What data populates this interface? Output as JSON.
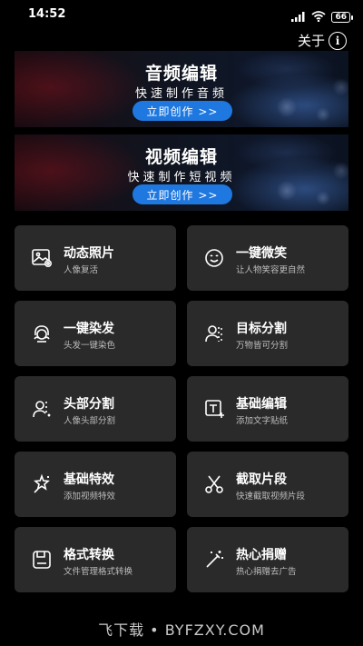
{
  "status_bar": {
    "time": "14:52",
    "battery": "66"
  },
  "header": {
    "about_label": "关于"
  },
  "banners": [
    {
      "title": "音频编辑",
      "subtitle": "快速制作音频",
      "button": "立即创作 >>"
    },
    {
      "title": "视频编辑",
      "subtitle": "快速制作短视频",
      "button": "立即创作 >>"
    }
  ],
  "features": [
    {
      "title": "动态照片",
      "subtitle": "人像复活",
      "icon": "photo-icon"
    },
    {
      "title": "一键微笑",
      "subtitle": "让人物笑容更自然",
      "icon": "smile-icon"
    },
    {
      "title": "一键染发",
      "subtitle": "头发一键染色",
      "icon": "hair-dye-icon"
    },
    {
      "title": "目标分割",
      "subtitle": "万物皆可分割",
      "icon": "segment-icon"
    },
    {
      "title": "头部分割",
      "subtitle": "人像头部分割",
      "icon": "head-segment-icon"
    },
    {
      "title": "基础编辑",
      "subtitle": "添加文字贴纸",
      "icon": "text-edit-icon"
    },
    {
      "title": "基础特效",
      "subtitle": "添加视频特效",
      "icon": "effects-icon"
    },
    {
      "title": "截取片段",
      "subtitle": "快速截取视频片段",
      "icon": "scissors-icon"
    },
    {
      "title": "格式转换",
      "subtitle": "文件管理格式转换",
      "icon": "save-icon"
    },
    {
      "title": "热心捐赠",
      "subtitle": "热心捐赠去广告",
      "icon": "magic-wand-icon"
    }
  ],
  "watermark": "飞下载 • BYFZXY.COM"
}
